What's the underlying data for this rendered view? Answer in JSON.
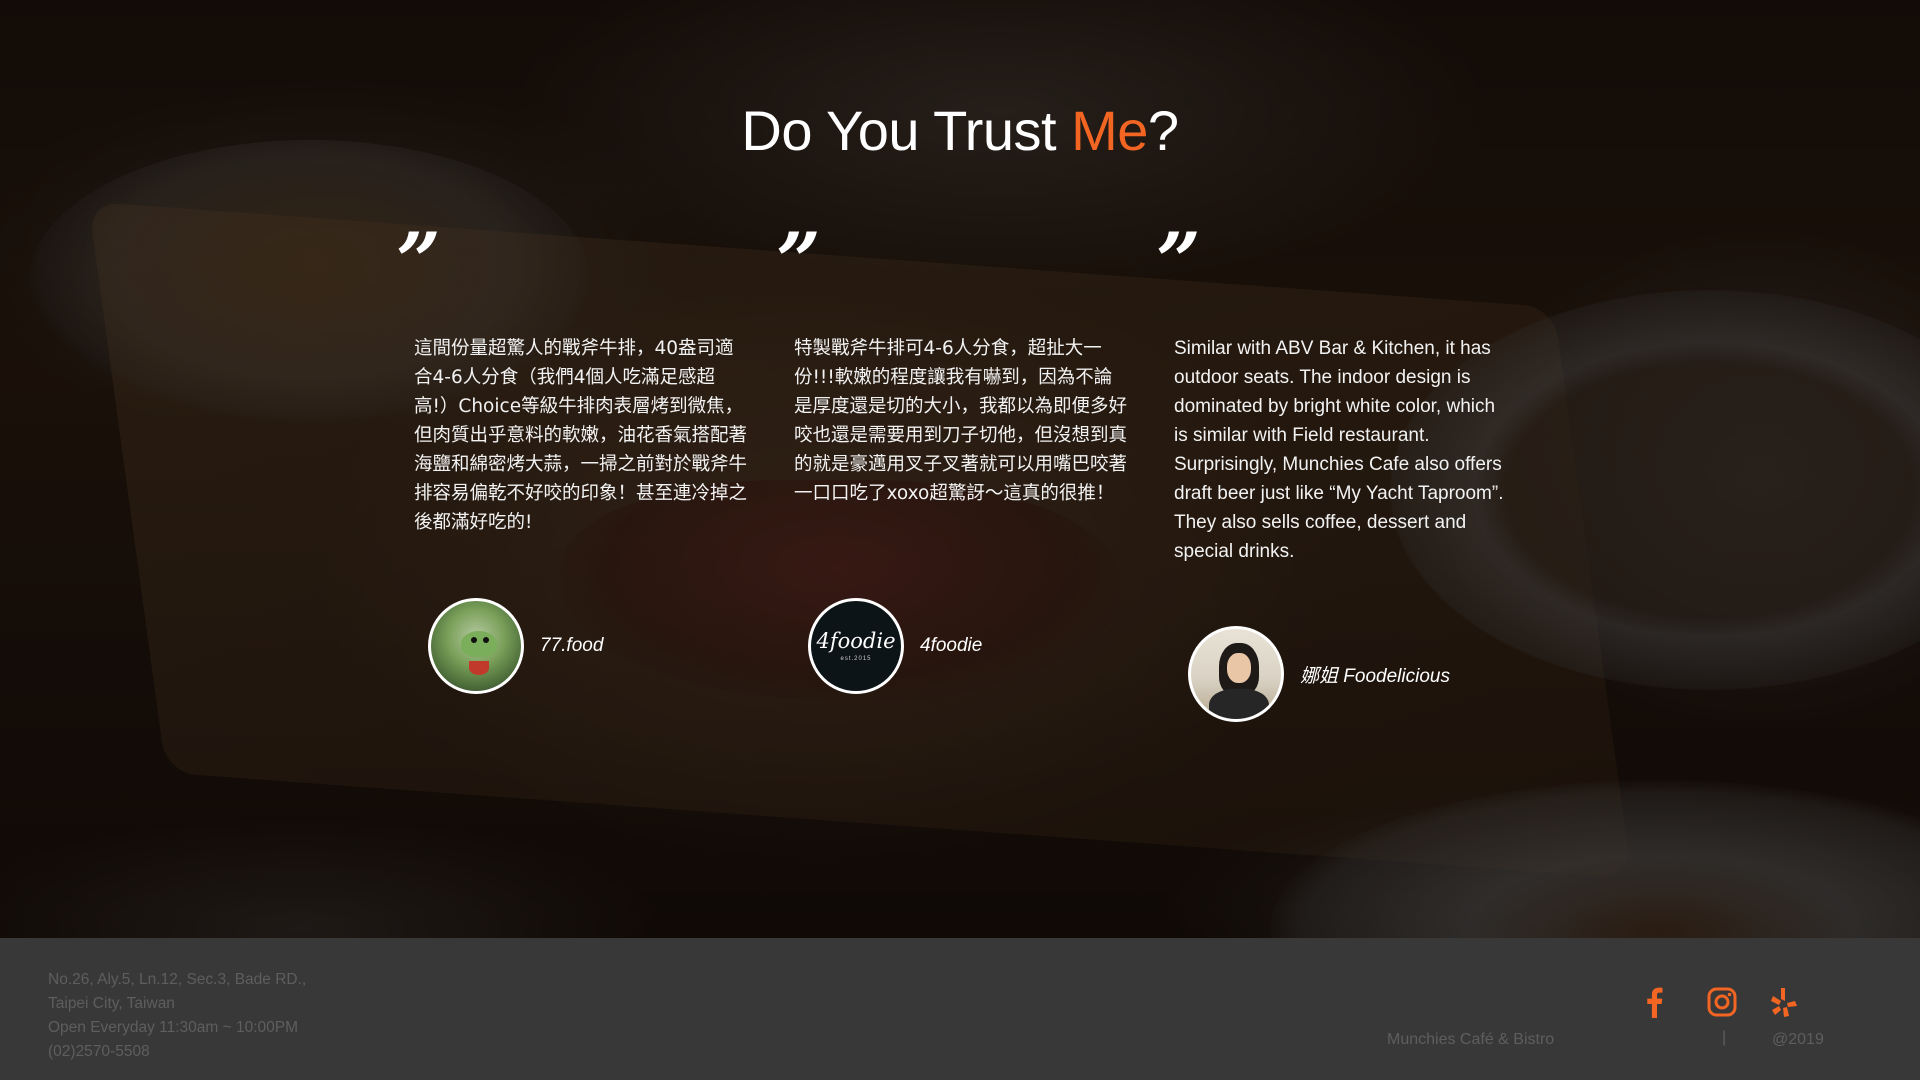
{
  "heading": {
    "prefix": "Do You Trust ",
    "accent": "Me",
    "suffix": "?"
  },
  "colors": {
    "accent": "#f26522",
    "footer_bg": "#383838",
    "footer_text": "#5e5e5e"
  },
  "testimonials": [
    {
      "quote_mark": "”",
      "text": "這間份量超驚人的戰斧牛排，40盎司適合4-6人分食（我們4個人吃滿足感超高!）Choice等級牛排肉表層烤到微焦，但肉質出乎意料的軟嫩，油花香氣搭配著海鹽和綿密烤大蒜，一掃之前對於戰斧牛排容易偏乾不好咬的印象！甚至連冷掉之後都滿好吃的!",
      "author": "77.food",
      "avatar_icon": "dinosaur-costume-avatar"
    },
    {
      "quote_mark": "”",
      "text": "特製戰斧牛排可4-6人分食，超扯大一份!!!軟嫩的程度讓我有嚇到，因為不論是厚度還是切的大小，我都以為即便多好咬也還是需要用到刀子切他，但沒想到真的就是豪邁用叉子叉著就可以用嘴巴咬著一口口吃了xoxo超驚訝～這真的很推！",
      "author": "4foodie",
      "avatar_logo": "4foodie",
      "avatar_est": "est.2015"
    },
    {
      "quote_mark": "”",
      "text": "Similar with ABV Bar & Kitchen, it has outdoor seats. The indoor design is dominated by bright white color, which is similar with Field restaurant. Surprisingly, Munchies Cafe also offers draft beer just like “My Yacht Taproom”. They also sells coffee, dessert and special drinks.",
      "author": "娜姐 Foodelicious",
      "avatar_icon": "person-photo-avatar"
    }
  ],
  "footer": {
    "address_lines": [
      "No.26, Aly.5, Ln.12, Sec.3, Bade RD.,",
      "Taipei City, Taiwan",
      "Open Everyday 11:30am ~ 10:00PM",
      "(02)2570-5508"
    ],
    "brand": "Munchies Café & Bistro",
    "separator": "|",
    "copyright": "@2019",
    "social": [
      "facebook-icon",
      "instagram-icon",
      "yelp-icon"
    ]
  }
}
